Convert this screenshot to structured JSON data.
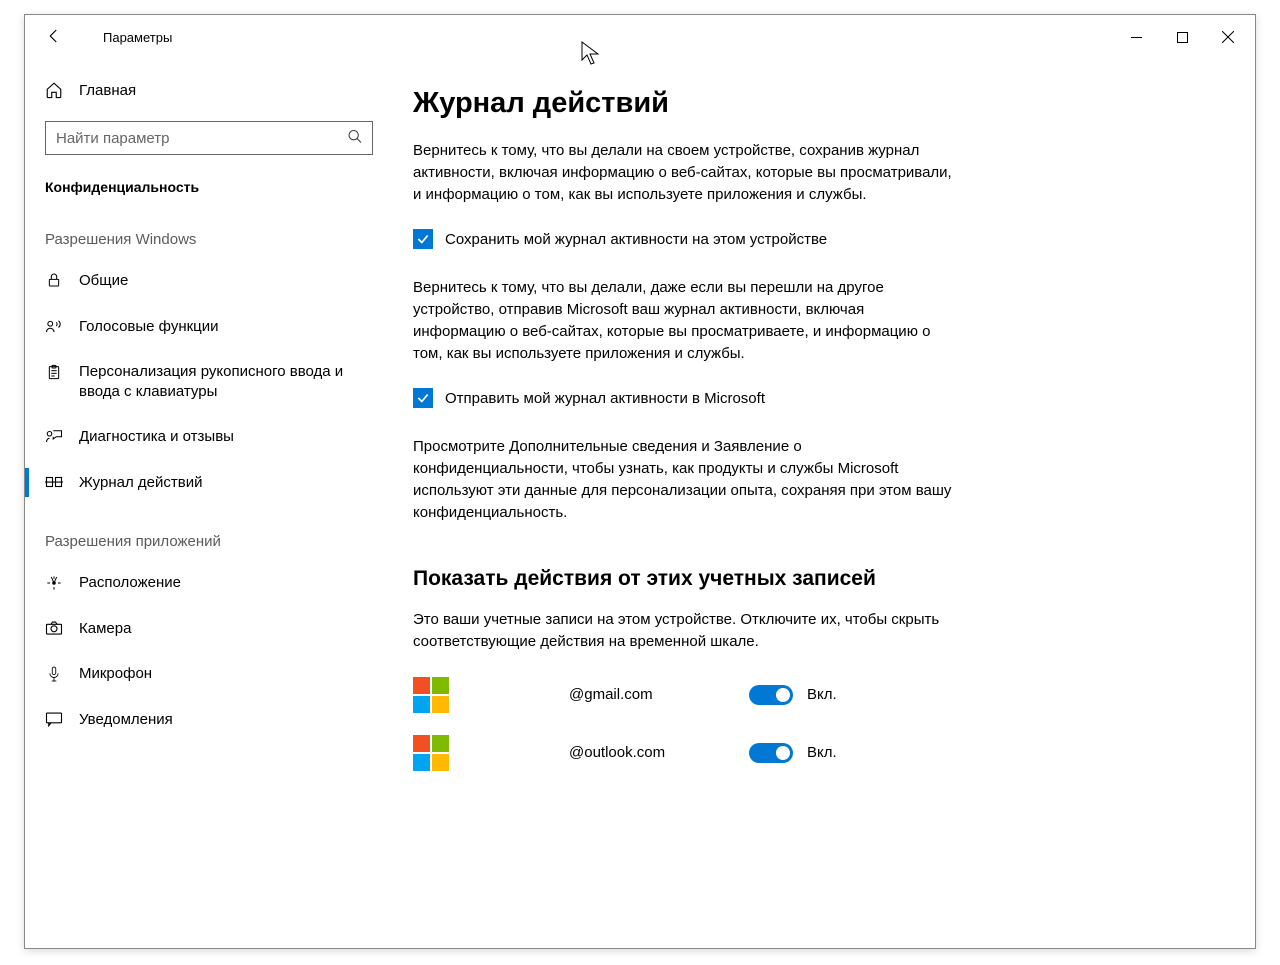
{
  "titlebar": {
    "title": "Параметры"
  },
  "sidebar": {
    "home": "Главная",
    "search_placeholder": "Найти параметр",
    "category": "Конфиденциальность",
    "group1": "Разрешения Windows",
    "items1": [
      {
        "label": "Общие"
      },
      {
        "label": "Голосовые функции"
      },
      {
        "label": "Персонализация рукописного ввода и ввода с клавиатуры"
      },
      {
        "label": "Диагностика и отзывы"
      },
      {
        "label": "Журнал действий"
      }
    ],
    "group2": "Разрешения приложений",
    "items2": [
      {
        "label": "Расположение"
      },
      {
        "label": "Камера"
      },
      {
        "label": "Микрофон"
      },
      {
        "label": "Уведомления"
      }
    ]
  },
  "main": {
    "heading": "Журнал действий",
    "p1": "Вернитесь к тому, что вы делали на своем устройстве, сохранив журнал активности, включая информацию о веб-сайтах, которые вы просматривали, и информацию о том, как вы используете приложения и службы.",
    "cb1": "Сохранить мой журнал активности на этом устройстве",
    "p2": "Вернитесь к тому, что вы делали, даже если вы перешли на другое устройство, отправив Microsoft ваш журнал активности, включая информацию о веб-сайтах, которые вы просматриваете, и информацию о том, как вы используете приложения и службы.",
    "cb2": "Отправить мой журнал активности в Microsoft",
    "p3": "Просмотрите Дополнительные сведения и Заявление о конфиденциальности, чтобы узнать, как продукты и службы Microsoft используют эти данные для персонализации опыта, сохраняя при этом вашу конфиденциальность.",
    "section": "Показать действия от этих учетных записей",
    "p4": "Это ваши учетные записи на этом устройстве. Отключите их, чтобы скрыть соответствующие действия на временной шкале.",
    "accounts": [
      {
        "email": "@gmail.com",
        "state": "Вкл."
      },
      {
        "email": "@outlook.com",
        "state": "Вкл."
      }
    ]
  }
}
